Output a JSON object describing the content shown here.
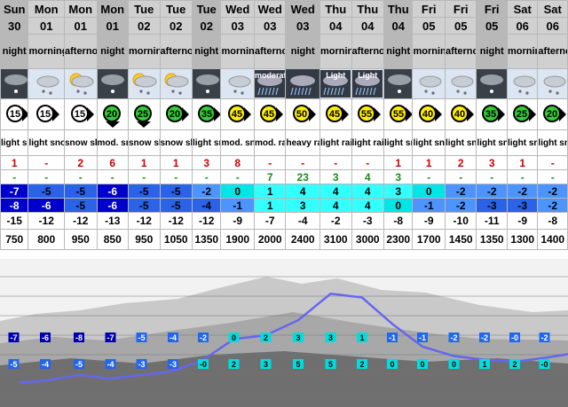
{
  "periods": [
    {
      "day": "Sun",
      "date": "30",
      "time": "night",
      "weather": "night-snow-icon",
      "wind": "15",
      "windDir": "arrow-right",
      "summary": "light snow",
      "snow": "1",
      "rain": "-",
      "tmax": "-7",
      "tmin": "-8",
      "chill": "-15",
      "freezing": "750"
    },
    {
      "day": "Mon",
      "date": "01",
      "time": "morning",
      "weather": "cloud-snow-icon",
      "wind": "15",
      "windDir": "arrow-right",
      "summary": "light snow",
      "snow": "-",
      "rain": "-",
      "tmax": "-5",
      "tmin": "-6",
      "chill": "-12",
      "freezing": "800"
    },
    {
      "day": "Mon",
      "date": "01",
      "time": "afternoon",
      "weather": "sun-cloud-snow-icon",
      "wind": "15",
      "windDir": "arrow-right",
      "summary": "snow shwrs",
      "snow": "2",
      "rain": "-",
      "tmax": "-5",
      "tmin": "-5",
      "chill": "-12",
      "freezing": "950"
    },
    {
      "day": "Mon",
      "date": "01",
      "time": "night",
      "weather": "night-snow-icon",
      "wind": "20",
      "windDir": "arrow-down",
      "summary": "mod. snow",
      "snow": "6",
      "rain": "-",
      "tmax": "-6",
      "tmin": "-6",
      "chill": "-13",
      "freezing": "850"
    },
    {
      "day": "Tue",
      "date": "02",
      "time": "morning",
      "weather": "sun-cloud-snow-icon",
      "wind": "25",
      "windDir": "arrow-down",
      "summary": "snow shwrs",
      "snow": "1",
      "rain": "-",
      "tmax": "-5",
      "tmin": "-5",
      "chill": "-12",
      "freezing": "950"
    },
    {
      "day": "Tue",
      "date": "02",
      "time": "afternoon",
      "weather": "sun-cloud-snow-icon",
      "wind": "20",
      "windDir": "arrow-right",
      "summary": "snow shwrs",
      "snow": "1",
      "rain": "-",
      "tmax": "-5",
      "tmin": "-5",
      "chill": "-12",
      "freezing": "1050"
    },
    {
      "day": "Tue",
      "date": "02",
      "time": "night",
      "weather": "night-snow-icon",
      "wind": "35",
      "windDir": "arrow-right",
      "summary": "light snow",
      "snow": "3",
      "rain": "-",
      "tmax": "-2",
      "tmin": "-4",
      "chill": "-12",
      "freezing": "1350"
    },
    {
      "day": "Wed",
      "date": "03",
      "time": "morning",
      "weather": "cloud-snow-icon",
      "wind": "45",
      "windDir": "arrow-right",
      "summary": "mod. snow",
      "snow": "8",
      "rain": "-",
      "tmax": "0",
      "tmin": "-1",
      "chill": "-9",
      "freezing": "1900"
    },
    {
      "day": "Wed",
      "date": "03",
      "time": "afternoon",
      "weather": "moderate-rain-icon",
      "weatherText": "moderate",
      "wind": "45",
      "windDir": "arrow-right",
      "summary": "mod. rain",
      "snow": "-",
      "rain": "7",
      "tmax": "1",
      "tmin": "1",
      "chill": "-7",
      "freezing": "2000"
    },
    {
      "day": "Wed",
      "date": "03",
      "time": "night",
      "weather": "heavy-rain-icon",
      "wind": "50",
      "windDir": "arrow-right",
      "summary": "heavy rain",
      "snow": "-",
      "rain": "23",
      "tmax": "4",
      "tmin": "3",
      "chill": "-4",
      "freezing": "2400"
    },
    {
      "day": "Thu",
      "date": "04",
      "time": "morning",
      "weather": "light-rain-icon",
      "weatherText": "Light",
      "wind": "45",
      "windDir": "arrow-right",
      "summary": "light rain",
      "snow": "-",
      "rain": "3",
      "tmax": "4",
      "tmin": "4",
      "chill": "-2",
      "freezing": "3100"
    },
    {
      "day": "Thu",
      "date": "04",
      "time": "afternoon",
      "weather": "light-rain-icon",
      "weatherText": "Light",
      "wind": "55",
      "windDir": "arrow-right",
      "summary": "light rain",
      "snow": "-",
      "rain": "4",
      "tmax": "4",
      "tmin": "4",
      "chill": "-3",
      "freezing": "3000"
    },
    {
      "day": "Thu",
      "date": "04",
      "time": "night",
      "weather": "night-snow-icon",
      "wind": "55",
      "windDir": "arrow-right",
      "summary": "light snow",
      "snow": "1",
      "rain": "3",
      "tmax": "3",
      "tmin": "0",
      "chill": "-8",
      "freezing": "2300"
    },
    {
      "day": "Fri",
      "date": "05",
      "time": "morning",
      "weather": "cloud-snow-icon",
      "wind": "40",
      "windDir": "arrow-right",
      "summary": "light snow",
      "snow": "1",
      "rain": "-",
      "tmax": "0",
      "tmin": "-1",
      "chill": "-9",
      "freezing": "1700"
    },
    {
      "day": "Fri",
      "date": "05",
      "time": "afternoon",
      "weather": "cloud-snow-icon",
      "wind": "40",
      "windDir": "arrow-right",
      "summary": "light snow",
      "snow": "2",
      "rain": "-",
      "tmax": "-2",
      "tmin": "-2",
      "chill": "-10",
      "freezing": "1450"
    },
    {
      "day": "Fri",
      "date": "05",
      "time": "night",
      "weather": "night-snow-icon",
      "wind": "35",
      "windDir": "arrow-right",
      "summary": "light snow",
      "snow": "3",
      "rain": "-",
      "tmax": "-2",
      "tmin": "-3",
      "chill": "-11",
      "freezing": "1350"
    },
    {
      "day": "Sat",
      "date": "06",
      "time": "morning",
      "weather": "cloud-snow-icon",
      "wind": "25",
      "windDir": "arrow-right",
      "summary": "light snow",
      "snow": "1",
      "rain": "-",
      "tmax": "-2",
      "tmin": "-3",
      "chill": "-9",
      "freezing": "1300"
    },
    {
      "day": "Sat",
      "date": "06",
      "time": "afternoon",
      "weather": "cloud-snow-icon",
      "wind": "20",
      "windDir": "arrow-right",
      "summary": "light snow",
      "snow": "-",
      "rain": "-",
      "tmax": "-2",
      "tmin": "-2",
      "chill": "-8",
      "freezing": "1400"
    }
  ],
  "colors": {
    "snow": "#cc0000",
    "rain": "#1a8a1a",
    "cold_dark": "#0000cc",
    "cold": "#3366ff",
    "cool": "#4d94ff",
    "warm": "#00ffff",
    "freezing_line": "#6666ee"
  },
  "chart_data": {
    "type": "line",
    "x": [
      1,
      2,
      3,
      4,
      5,
      6,
      7,
      8,
      9,
      10,
      11,
      12,
      13,
      14,
      15,
      16,
      17,
      18
    ],
    "series": [
      {
        "values": [
          750,
          800,
          950,
          850,
          950,
          1050,
          1350,
          1900,
          2000,
          2400,
          3100,
          3000,
          2300,
          1700,
          1450,
          1350,
          1300,
          1400
        ]
      }
    ],
    "top_labels": [
      "-7",
      "-6",
      "-8",
      "-7",
      "-5",
      "-4",
      "-2",
      "0",
      "2",
      "3",
      "3",
      "1",
      "-1",
      "-1",
      "-2",
      "-2",
      "-0",
      "-2"
    ],
    "bottom_labels": [
      "-5",
      "-4",
      "-5",
      "-4",
      "-3",
      "-3",
      "-0",
      "2",
      "3",
      "5",
      "5",
      "2",
      "0",
      "0",
      "0",
      "1",
      "2",
      "-0"
    ],
    "top_colors": [
      "#0000aa",
      "#0000aa",
      "#0000aa",
      "#0000aa",
      "#2266ee",
      "#2266ee",
      "#2266ee",
      "#00dddd",
      "#00dddd",
      "#00dddd",
      "#00dddd",
      "#00dddd",
      "#2266ee",
      "#2266ee",
      "#2266ee",
      "#2266ee",
      "#2266ee",
      "#2266ee"
    ],
    "bottom_colors": [
      "#2266ee",
      "#2266ee",
      "#2266ee",
      "#2266ee",
      "#2266ee",
      "#2266ee",
      "#00dddd",
      "#00dddd",
      "#00dddd",
      "#00dddd",
      "#00dddd",
      "#00dddd",
      "#00dddd",
      "#00dddd",
      "#00dddd",
      "#00dddd",
      "#00dddd",
      "#00dddd"
    ],
    "ylim": [
      500,
      3200
    ]
  }
}
